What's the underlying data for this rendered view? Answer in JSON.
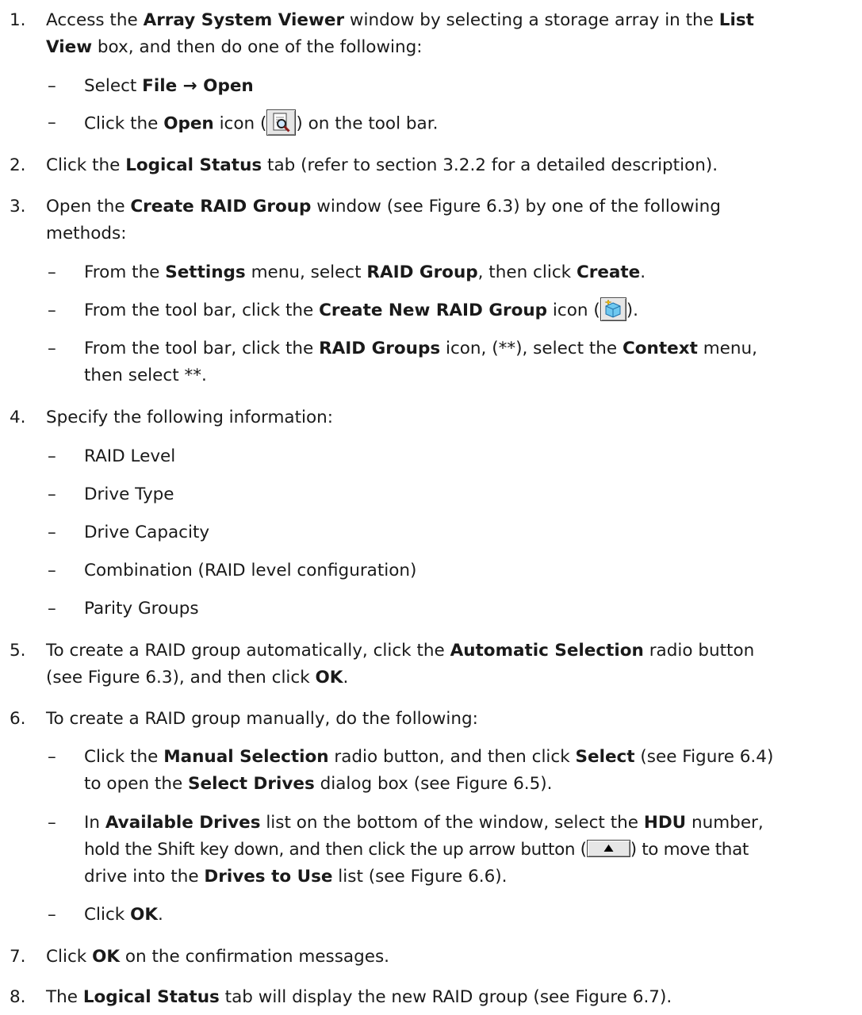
{
  "steps": [
    {
      "num": "1.",
      "text": [
        [
          "Access the ",
          "Array System Viewer",
          " window by selecting a storage array in the ",
          "List"
        ],
        [
          "View",
          " box, and then do one of the following:"
        ]
      ],
      "subs": [
        [
          "Select ",
          "File → Open"
        ],
        [
          "Click the ",
          "Open",
          " icon (",
          ") on the tool bar."
        ]
      ]
    },
    {
      "num": "2.",
      "text": [
        [
          "Click the ",
          "Logical Status",
          " tab (refer to section 3.2.2 for a detailed description)."
        ]
      ]
    },
    {
      "num": "3.",
      "text": [
        [
          "Open the ",
          "Create RAID Group",
          " window (see Figure 6.3) by one of the following"
        ],
        [
          "methods:"
        ]
      ],
      "subs": [
        [
          "From the ",
          "Settings",
          " menu, select ",
          "RAID Group",
          ", then click ",
          "Create",
          "."
        ],
        [
          "From the tool bar, click the ",
          "Create New RAID Group",
          " icon (",
          ")."
        ],
        [
          "From the tool bar, click the ",
          "RAID Groups",
          " icon, (**), select the ",
          "Context",
          " menu,",
          "then select **."
        ]
      ]
    },
    {
      "num": "4.",
      "text": [
        [
          "Specify the following information:"
        ]
      ],
      "subs": [
        [
          "RAID Level"
        ],
        [
          "Drive Type"
        ],
        [
          "Drive Capacity"
        ],
        [
          "Combination (RAID level configuration)"
        ],
        [
          "Parity Groups"
        ]
      ]
    },
    {
      "num": "5.",
      "text": [
        [
          "To create a RAID group automatically, click the ",
          "Automatic Selection",
          " radio button"
        ],
        [
          "(see Figure 6.3), and then click ",
          "OK",
          "."
        ]
      ]
    },
    {
      "num": "6.",
      "text": [
        [
          "To create a RAID group manually, do the following:"
        ]
      ],
      "subs": [
        [
          "Click the ",
          "Manual Selection",
          " radio button, and then click ",
          "Select",
          " (see Figure 6.4)",
          "to open the ",
          "Select Drives",
          " dialog box (see Figure 6.5)."
        ],
        [
          "In ",
          "Available Drives",
          " list on the bottom of the window, select the ",
          "HDU",
          " number,",
          "hold the Shift key down, and then click the up arrow button (",
          ") to move that",
          "drive into the ",
          "Drives to Use",
          " list (see Figure 6.6)."
        ],
        [
          "Click ",
          "OK",
          "."
        ]
      ]
    },
    {
      "num": "7.",
      "text": [
        [
          "Click ",
          "OK",
          " on the confirmation messages."
        ]
      ]
    },
    {
      "num": "8.",
      "text": [
        [
          "The ",
          "Logical Status",
          " tab will display the new RAID group (see Figure 6.7)."
        ]
      ]
    }
  ],
  "dash_char": "–",
  "icons": {
    "open": "magnifier-page-icon",
    "create": "new-raid-cube-icon",
    "up": "up-arrow-button-icon"
  }
}
